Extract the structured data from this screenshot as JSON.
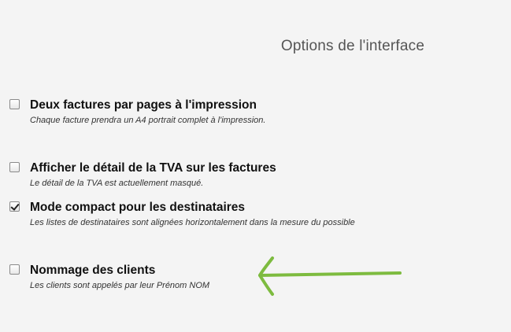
{
  "page": {
    "title": "Options de l'interface"
  },
  "options": [
    {
      "label": "Deux factures par pages à l'impression",
      "description": "Chaque facture prendra un A4 portrait complet à l'impression.",
      "checked": false
    },
    {
      "label": "Afficher le détail de la TVA sur les factures",
      "description": "Le détail de la TVA est actuellement masqué.",
      "checked": false
    },
    {
      "label": "Mode compact pour les destinataires",
      "description": "Les listes de destinataires sont alignées horizontalement dans la mesure du possible",
      "checked": true
    },
    {
      "label": "Nommage des clients",
      "description": "Les clients sont appelés par leur Prénom NOM",
      "checked": false
    }
  ],
  "annotation": {
    "color": "#7dbb3f",
    "icon": "arrow-left-icon"
  }
}
